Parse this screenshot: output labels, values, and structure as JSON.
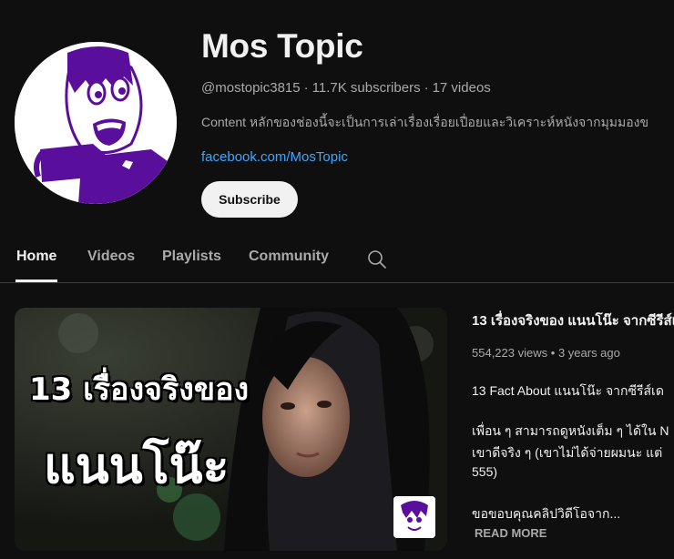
{
  "channel": {
    "name": "Mos Topic",
    "handle": "@mostopic3815",
    "subscribers": "11.7K subscribers",
    "videos": "17 videos",
    "separator": "·",
    "description": "Content หลักของช่องนี้จะเป็นการเล่าเรื่องเรื่อยเปื่อยและวิเคราะห์หนังจากมุมมองข",
    "link": "facebook.com/MosTopic",
    "subscribe_label": "Subscribe",
    "avatar_colors": {
      "primary": "#5a0f9c",
      "background": "#ffffff"
    }
  },
  "tabs": [
    {
      "label": "Home",
      "active": true
    },
    {
      "label": "Videos",
      "active": false
    },
    {
      "label": "Playlists",
      "active": false
    },
    {
      "label": "Community",
      "active": false
    }
  ],
  "search_icon": "search-icon",
  "featured_video": {
    "thumbnail_text_line1": "13 เรื่องจริงของ",
    "thumbnail_text_line2": "แนนโน๊ะ",
    "title": "13 เรื่องจริงของ แนนโน๊ะ จากซีรีส์เ",
    "views": "554,223 views",
    "age": "3 years ago",
    "meta_separator": "•",
    "description_lines": [
      "13 Fact About แนนโน๊ะ จากซีรีส์เด",
      "เพื่อน ๆ สามารถดูหนังเต็ม ๆ ได้ใน N",
      "เขาดีจริง ๆ (เขาไม่ได้จ่ายผมนะ แต่",
      "555)",
      "ขอขอบคุณคลิปวิดีโอจาก..."
    ],
    "read_more": "READ MORE"
  }
}
